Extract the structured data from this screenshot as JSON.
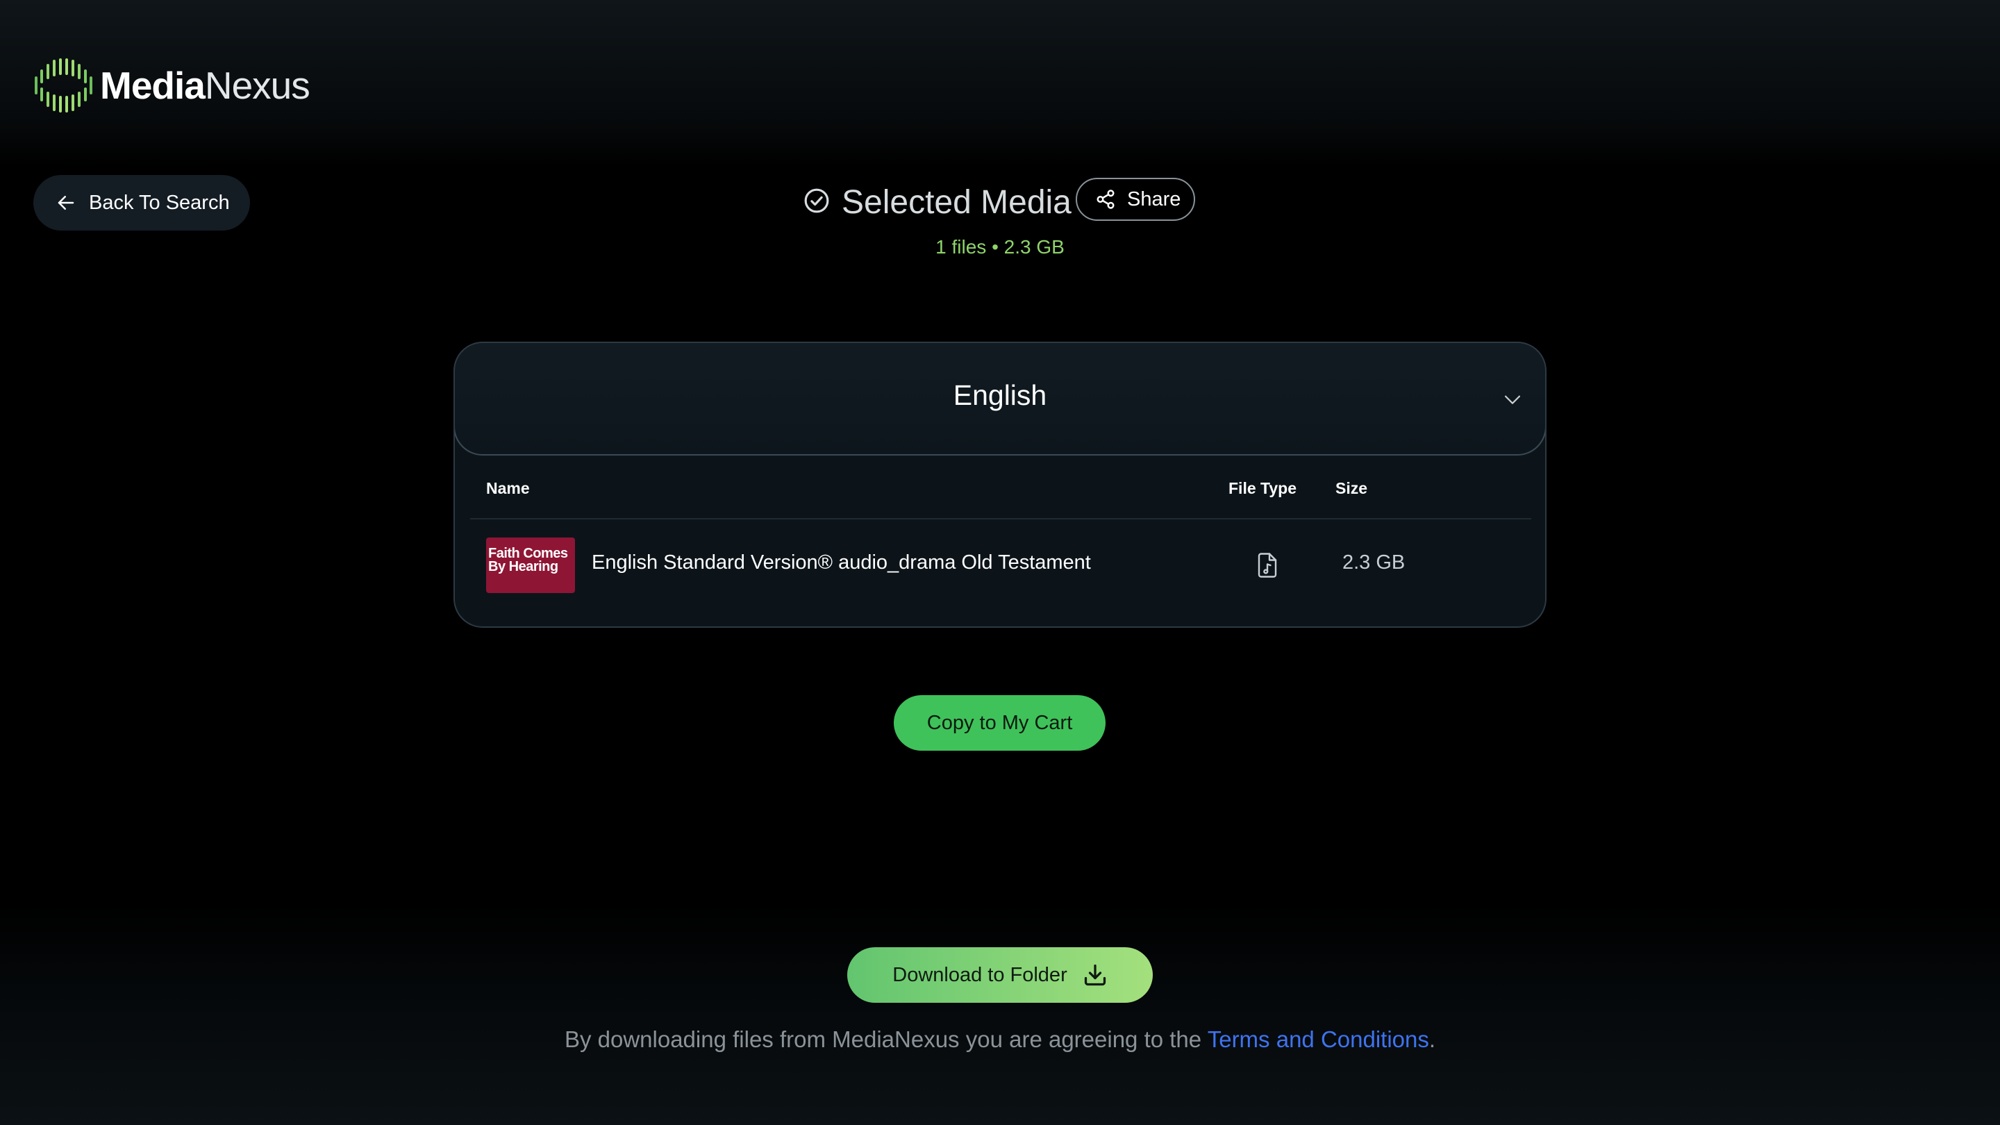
{
  "brand": {
    "name_bold": "Media",
    "name_light": "Nexus",
    "accent": "#8fd46a"
  },
  "nav": {
    "back_label": "Back To Search"
  },
  "header": {
    "title": "Selected Media",
    "share_label": "Share",
    "summary": "1 files • 2.3 GB"
  },
  "card": {
    "title": "English",
    "columns": {
      "name": "Name",
      "file_type": "File Type",
      "size": "Size"
    },
    "rows": [
      {
        "thumbnail_line1": "Faith Comes",
        "thumbnail_line2": "By Hearing",
        "name": "English Standard Version® audio_drama Old Testament",
        "file_type_icon": "audio-file-icon",
        "size": "2.3 GB"
      }
    ]
  },
  "actions": {
    "copy_label": "Copy to My Cart",
    "download_label": "Download to Folder"
  },
  "footer": {
    "terms_prefix": "By downloading files from MediaNexus you are agreeing to the ",
    "terms_link": "Terms and Conditions",
    "terms_suffix": "."
  },
  "colors": {
    "copy_button": "#3fc25a",
    "download_gradient_start": "#62c56f",
    "download_gradient_end": "#a4e07d",
    "link": "#3e73f0",
    "thumbnail_bg": "#8f1535"
  }
}
